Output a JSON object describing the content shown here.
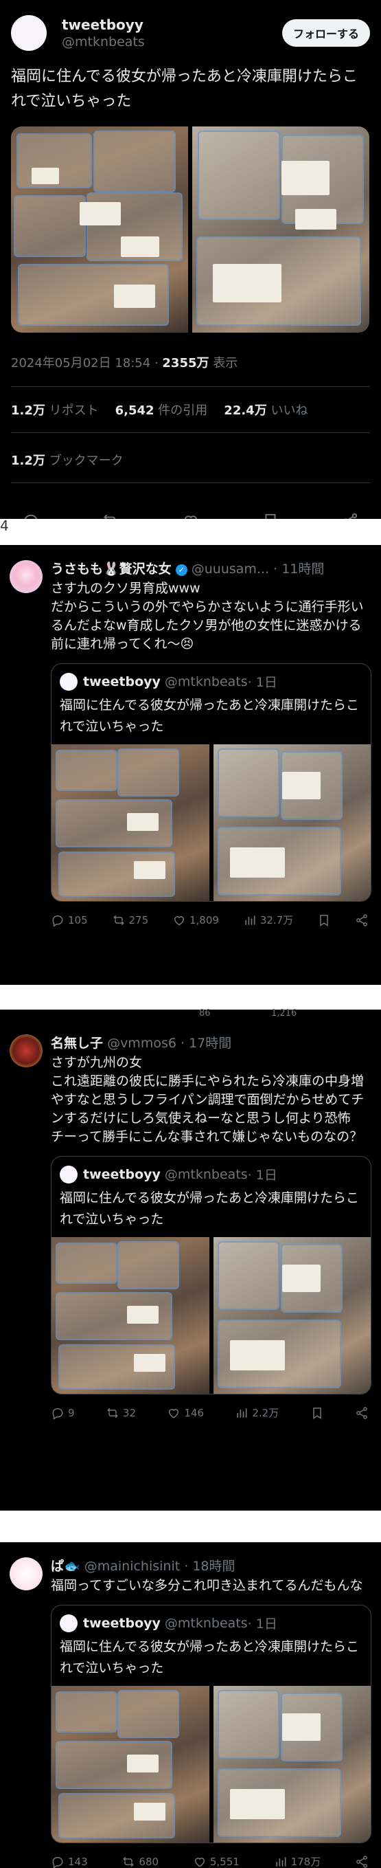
{
  "main_tweet": {
    "name": "tweetboyy",
    "handle": "@mtknbeats",
    "follow_label": "フォローする",
    "text": "福岡に住んでる彼女が帰ったあと冷凍庫開けたらこれで泣いちゃった",
    "date": "2024年05月02日 18:54",
    "views_count": "2355万",
    "views_label": "表示",
    "reposts_count": "1.2万",
    "reposts_label": "リポスト",
    "quotes_count": "6,542",
    "quotes_label": "件の引用",
    "likes_count": "22.4万",
    "likes_label": "いいね",
    "bookmarks_count": "1.2万",
    "bookmarks_label": "ブックマーク"
  },
  "separator_mark": "4",
  "quoted": {
    "name": "tweetboyy",
    "handle": "@mtknbeats",
    "time": "· 1日",
    "text": "福岡に住んでる彼女が帰ったあと冷凍庫開けたらこれで泣いちゃった"
  },
  "quote_tweets": [
    {
      "name": "うさもも🐰贅沢な女",
      "handle": "@uuusam...",
      "time": "· 11時間",
      "verified": true,
      "text": "さす九のクソ男育成www\nだからこういうの外でやらかさないように通行手形いるんだよなw育成したクソ男が他の女性に迷惑かける前に連れ帰ってくれ〜😣",
      "replies": "105",
      "reposts": "275",
      "likes": "1,809",
      "views": "32.7万"
    },
    {
      "name": "名無し子",
      "handle": "@vmmos6",
      "time": "· 17時間",
      "verified": false,
      "text": "さすが九州の女\nこれ遠距離の彼氏に勝手にやられたら冷凍庫の中身増やすなと思うしフライパン調理で面倒だからせめてチンするだけにしろ気使えねーなと思うし何より恐怖\nチーって勝手にこんな事されて嫌じゃないものなの？",
      "replies": "9",
      "reposts": "32",
      "likes": "146",
      "views": "2.2万"
    },
    {
      "name": "ぱ🐟",
      "handle": "@mainichisinit",
      "time": "· 18時間",
      "verified": false,
      "text": "福岡ってすごいな多分これ叩き込まれてるんだもんな",
      "replies": "143",
      "reposts": "680",
      "likes": "5,551",
      "views": "178万"
    }
  ],
  "cut_counts": [
    "86",
    "1,216"
  ],
  "colors": {
    "background": "#000000",
    "text": "#e7e9ea",
    "muted": "#71767b",
    "verified": "#1d9bf0",
    "separator": "#ffffff"
  }
}
